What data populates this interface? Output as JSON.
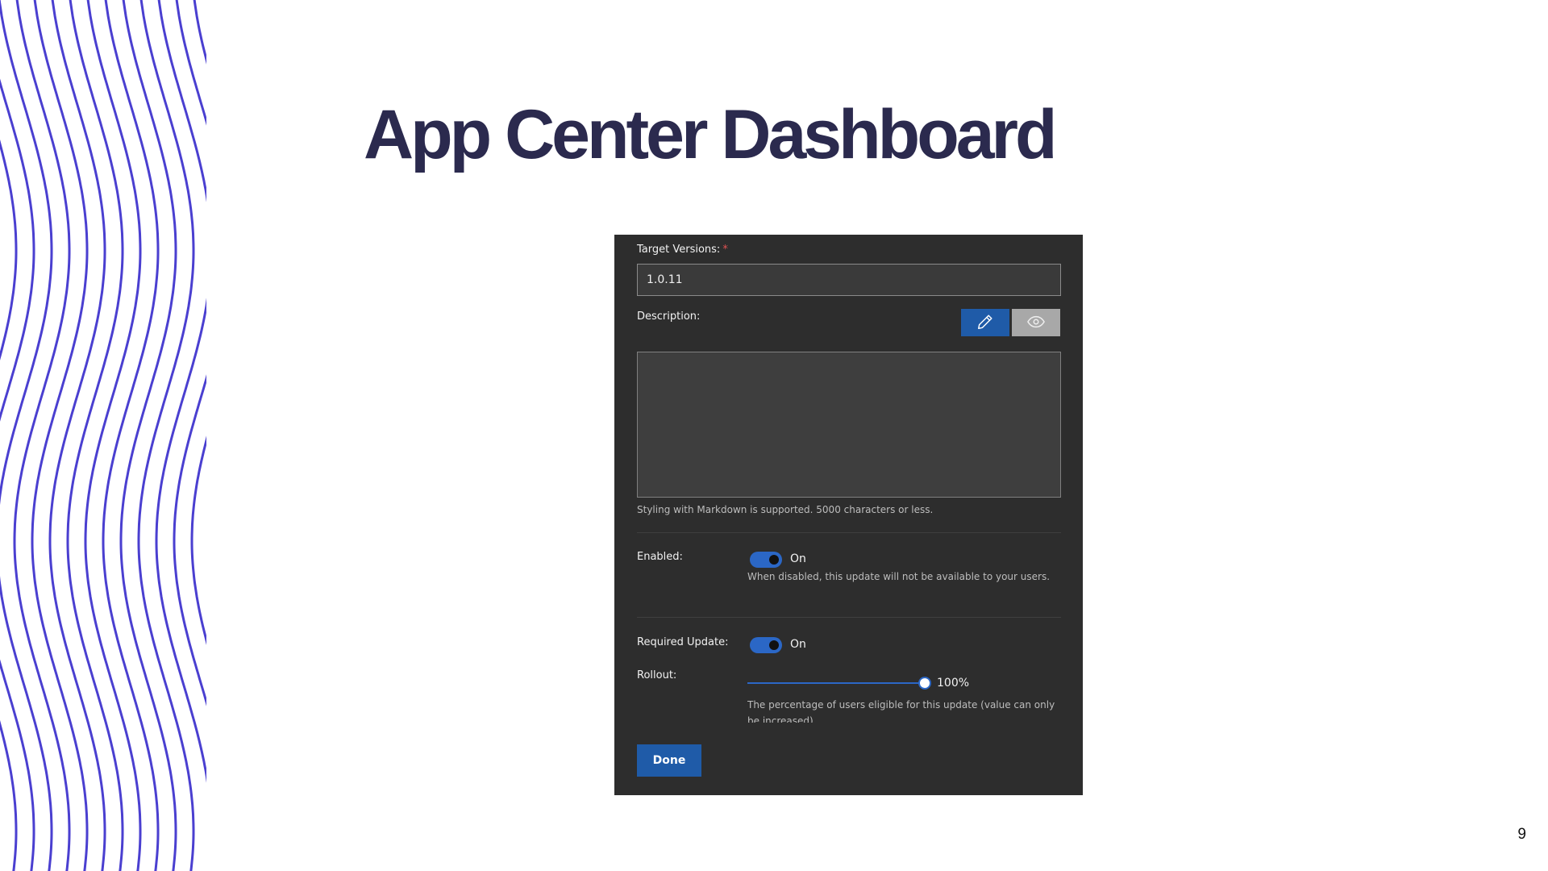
{
  "slide": {
    "title": "App Center Dashboard",
    "page_number": "9",
    "accent_color": "#4a3fd0"
  },
  "form": {
    "target_versions_label": "Target Versions:",
    "required_marker": "*",
    "target_versions_value": "1.0.11",
    "description_label": "Description:",
    "edit_mode_icon": "pencil-icon",
    "preview_mode_icon": "eye-icon",
    "description_value": "",
    "markdown_hint": "Styling with Markdown is supported. 5000 characters or less.",
    "enabled_label": "Enabled:",
    "enabled_state": "On",
    "enabled_on": true,
    "enabled_hint": "When disabled, this update will not be available to your users.",
    "required_update_label": "Required Update:",
    "required_update_state": "On",
    "required_update_on": true,
    "rollout_label": "Rollout:",
    "rollout_percent": 100,
    "rollout_display": "100%",
    "rollout_hint": "The percentage of users eligible for this update (value can only be increased).",
    "done_label": "Done"
  },
  "colors": {
    "panel_bg": "#2d2d2d",
    "primary_button": "#1f5ba8",
    "toggle_on": "#2b67c6"
  }
}
